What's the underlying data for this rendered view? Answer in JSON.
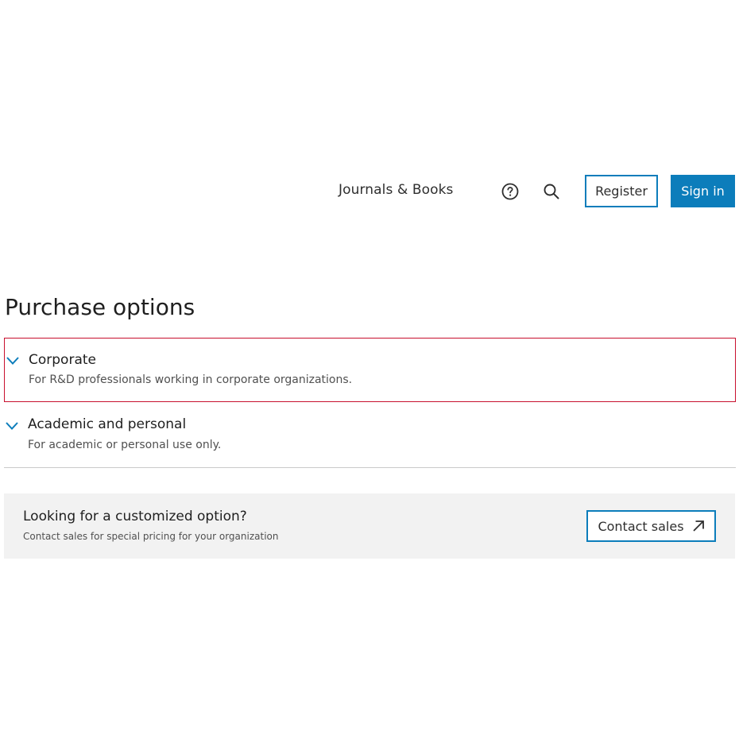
{
  "header": {
    "nav_link": "Journals & Books",
    "help_icon": "help-circle-icon",
    "search_icon": "search-icon",
    "register_label": "Register",
    "signin_label": "Sign in",
    "accent_color": "#0c7dbb"
  },
  "main": {
    "title": "Purchase options",
    "options": [
      {
        "title": "Corporate",
        "description": "For R&D professionals working in corporate organizations.",
        "icon": "chevron-down-icon",
        "highlighted": true
      },
      {
        "title": "Academic and personal",
        "description": "For academic or personal use only.",
        "icon": "chevron-down-icon",
        "highlighted": false
      }
    ],
    "custom": {
      "title": "Looking for a customized option?",
      "subtitle": "Contact sales for special pricing for your organization",
      "button_label": "Contact sales",
      "button_icon": "external-arrow-icon"
    }
  },
  "colors": {
    "highlight_border": "#c8102e",
    "panel_background": "#f2f2f2"
  }
}
